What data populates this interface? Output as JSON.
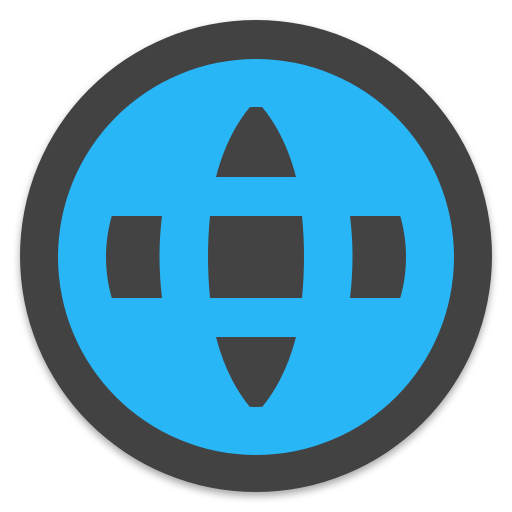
{
  "icon": {
    "name": "globe-icon",
    "colors": {
      "badge": "#434343",
      "globe": "#29B6F6",
      "background": "#FFFFFF"
    }
  }
}
